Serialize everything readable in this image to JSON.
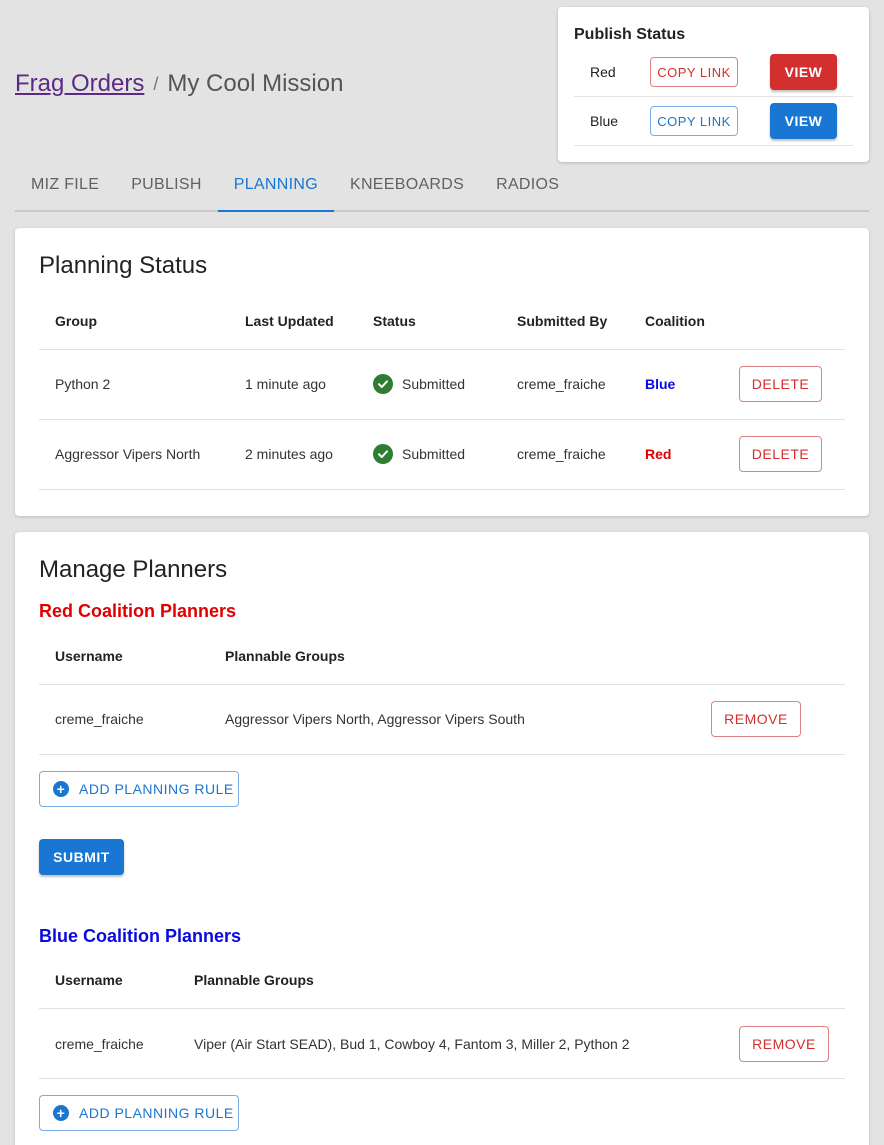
{
  "breadcrumb": {
    "parent": "Frag Orders",
    "separator": "/",
    "current": "My Cool Mission"
  },
  "publish_status": {
    "title": "Publish Status",
    "rows": [
      {
        "name": "Red",
        "copy_label": "COPY LINK",
        "view_label": "VIEW"
      },
      {
        "name": "Blue",
        "copy_label": "COPY LINK",
        "view_label": "VIEW"
      }
    ]
  },
  "tabs": [
    "MIZ FILE",
    "PUBLISH",
    "PLANNING",
    "KNEEBOARDS",
    "RADIOS"
  ],
  "active_tab": "PLANNING",
  "planning_status": {
    "title": "Planning Status",
    "columns": [
      "Group",
      "Last Updated",
      "Status",
      "Submitted By",
      "Coalition"
    ],
    "rows": [
      {
        "group": "Python 2",
        "last_updated": "1 minute ago",
        "status": "Submitted",
        "submitted_by": "creme_fraiche",
        "coalition": "Blue",
        "action": "DELETE"
      },
      {
        "group": "Aggressor Vipers North",
        "last_updated": "2 minutes ago",
        "status": "Submitted",
        "submitted_by": "creme_fraiche",
        "coalition": "Red",
        "action": "DELETE"
      }
    ]
  },
  "manage_planners": {
    "title": "Manage Planners",
    "red": {
      "heading": "Red Coalition Planners",
      "columns": [
        "Username",
        "Plannable Groups"
      ],
      "rows": [
        {
          "username": "creme_fraiche",
          "groups": "Aggressor Vipers North, Aggressor Vipers South",
          "action": "REMOVE"
        }
      ],
      "add_label": "ADD PLANNING RULE",
      "submit_label": "SUBMIT"
    },
    "blue": {
      "heading": "Blue Coalition Planners",
      "columns": [
        "Username",
        "Plannable Groups"
      ],
      "rows": [
        {
          "username": "creme_fraiche",
          "groups": "Viper (Air Start SEAD), Bud 1, Cowboy 4, Fantom 3, Miller 2, Python 2",
          "action": "REMOVE"
        }
      ],
      "add_label": "ADD PLANNING RULE"
    }
  },
  "colors": {
    "primary": "#1976d2",
    "error": "#d32f2f",
    "red_coalition": "#e00000",
    "blue_coalition": "#0a0ae0",
    "status_ok": "#2e7d32",
    "link": "#5b2a86"
  },
  "icons": {
    "status": "check-circle-icon",
    "add": "add-circle-icon"
  }
}
